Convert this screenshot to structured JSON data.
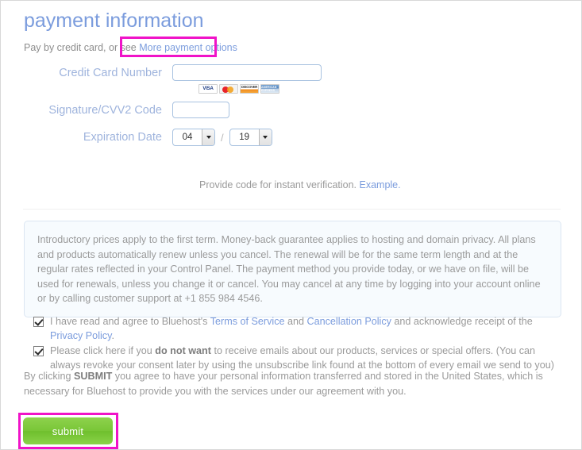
{
  "header": {
    "title": "payment information",
    "subtitle_prefix": "Pay by credit card, or see ",
    "more_options_link": "More payment options"
  },
  "form": {
    "credit_card": {
      "label": "Credit Card Number",
      "value": "",
      "placeholder": ""
    },
    "cvv": {
      "label": "Signature/CVV2 Code",
      "value": "",
      "placeholder": ""
    },
    "expiration": {
      "label": "Expiration Date",
      "month_value": "04",
      "separator": "/",
      "year_value": "19"
    },
    "card_logos": [
      {
        "name": "visa-logo",
        "text": "VISA"
      },
      {
        "name": "mastercard-logo",
        "text": ""
      },
      {
        "name": "discover-logo",
        "text": "DISCOVER"
      },
      {
        "name": "amex-logo",
        "text": "AMERICAN EXPRESS"
      }
    ],
    "verification": {
      "text": "Provide code for instant verification. ",
      "example_link": "Example."
    }
  },
  "disclaimer": {
    "text": "Introductory prices apply to the first term. Money-back guarantee applies to hosting and domain privacy. All plans and products automatically renew unless you cancel. The renewal will be for the same term length and at the regular rates reflected in your Control Panel. The payment method you provide today, or we have on file, will be used for renewals, unless you change it or cancel. You may cancel at any time by logging into your account online or by calling customer support at +1 855 984 4546."
  },
  "agreements": {
    "terms": {
      "checked": true,
      "part1": "I have read and agree to Bluehost's ",
      "link1": "Terms of Service",
      "part2": " and ",
      "link2": "Cancellation Policy",
      "part3": " and acknowledge receipt of the ",
      "link3": "Privacy Policy",
      "part4": "."
    },
    "marketing": {
      "checked": true,
      "part1": "Please click here if you ",
      "bold": "do not want",
      "part2": " to receive emails about our products, services or special offers. (You can always revoke your consent later by using the unsubscribe link found at the bottom of every email we send to you)"
    }
  },
  "submit_note": {
    "part1": "By clicking ",
    "bold": "SUBMIT",
    "part2": " you agree to have your personal information transferred and stored in the United States, which is necessary for Bluehost to provide you with the services under our agreement with you."
  },
  "submit_button": {
    "label": "submit"
  },
  "colors": {
    "title": "#7b9cdd",
    "label": "#9fb4dd",
    "link": "#7b9cdd",
    "highlight": "#f013c8",
    "submit_green": "#7bc83a",
    "info_bg": "#f7fbfe",
    "info_border": "#dbe6f2"
  }
}
